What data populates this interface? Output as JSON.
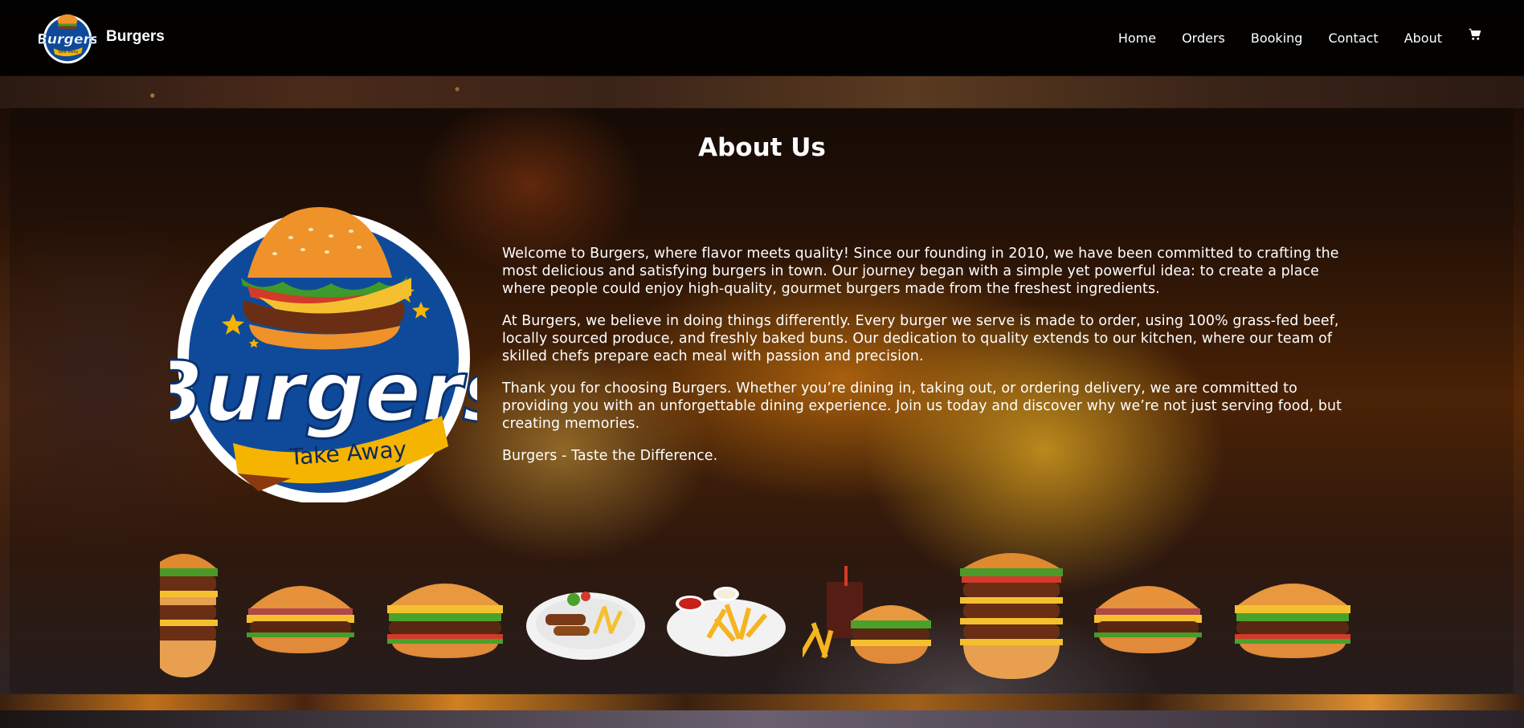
{
  "brand": {
    "name": "Burgers",
    "logo_text": "Burgers",
    "logo_subtext": "Take Away"
  },
  "nav": {
    "items": [
      "Home",
      "Orders",
      "Booking",
      "Contact",
      "About"
    ],
    "cart_icon": "cart-icon"
  },
  "page": {
    "title": "About Us"
  },
  "about": {
    "paragraphs": [
      "Welcome to Burgers, where flavor meets quality! Since our founding in 2010, we have been committed to crafting the most delicious and satisfying burgers in town. Our journey began with a simple yet powerful idea: to create a place where people could enjoy high-quality, gourmet burgers made from the freshest ingredients.",
      "At Burgers, we believe in doing things differently. Every burger we serve is made to order, using 100% grass-fed beef, locally sourced produce, and freshly baked buns. Our dedication to quality extends to our kitchen, where our team of skilled chefs prepare each meal with passion and precision.",
      "Thank you for choosing Burgers. Whether you’re dining in, taking out, or ordering delivery, we are committed to providing you with an unforgettable dining experience. Join us today and discover why we’re not just serving food, but creating memories.",
      "Burgers - Taste the Difference."
    ]
  },
  "gallery": {
    "items": [
      "triple-burger",
      "bacon-burger",
      "cheese-burger",
      "kebab-plate",
      "fries-plate",
      "burger-combo",
      "triple-burger",
      "bacon-burger",
      "cheese-burger"
    ]
  },
  "colors": {
    "logo_blue": "#0f4a9a",
    "logo_yellow": "#f5b400",
    "bun_orange": "#f0922a"
  }
}
